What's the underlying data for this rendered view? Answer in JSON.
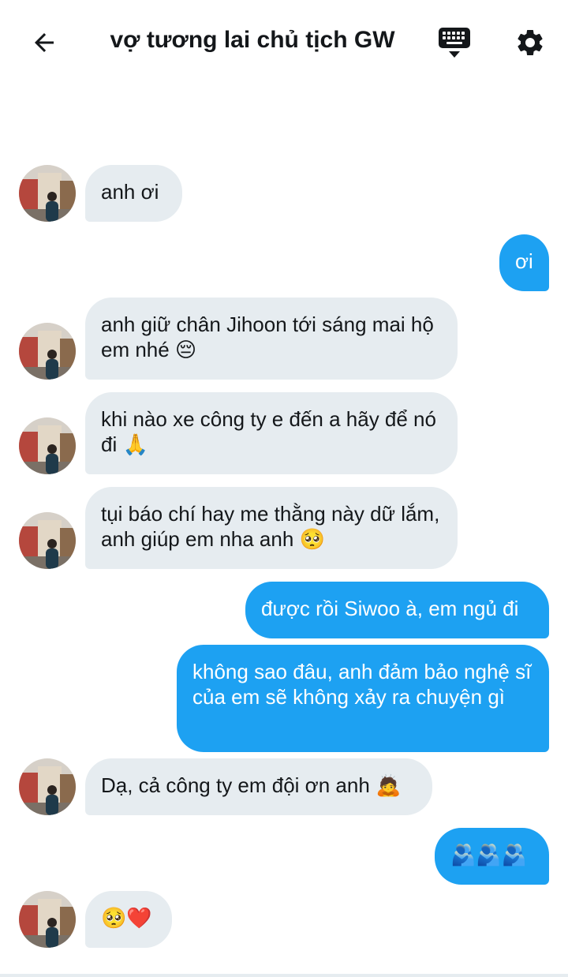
{
  "header": {
    "title": "vợ tương lai chủ tịch GW",
    "back_icon": "arrow-left-icon",
    "keyboard_icon": "keyboard-icon",
    "settings_icon": "gear-icon"
  },
  "colors": {
    "outgoing_bubble": "#1da1f2",
    "incoming_bubble": "#e6ecf0"
  },
  "messages": [
    {
      "from": "them",
      "text": "anh ơi"
    },
    {
      "from": "me",
      "text": "ơi"
    },
    {
      "from": "them",
      "text": "anh giữ chân Jihoon tới sáng mai hộ em nhé 😔"
    },
    {
      "from": "them",
      "text": "khi nào xe công ty e đến a hãy để nó đi 🙏"
    },
    {
      "from": "them",
      "text": "tụi báo chí hay me thằng này dữ lắm, anh giúp em nha anh 🥺"
    },
    {
      "from": "me",
      "text": "được rồi Siwoo à, em ngủ đi"
    },
    {
      "from": "me",
      "text": "không sao đâu, anh đảm bảo nghệ sĩ của em sẽ không xảy ra chuyện gì"
    },
    {
      "from": "them",
      "text": "Dạ, cả công ty em đội ơn anh 🙇"
    },
    {
      "from": "me",
      "text": "🫂🫂🫂"
    },
    {
      "from": "them",
      "text": "🥺❤️"
    }
  ]
}
